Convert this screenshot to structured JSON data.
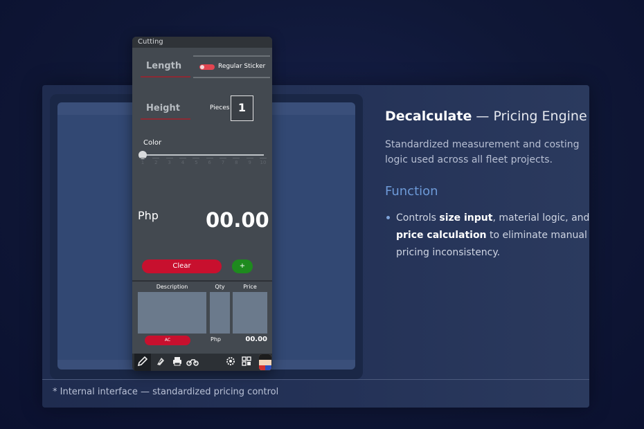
{
  "card": {
    "heading_bold": "Decalculate",
    "heading_rest": " — Pricing Engine",
    "description": "Standardized measurement and costing logic used across all fleet projects.",
    "function_title": "Function",
    "bullet": {
      "p1": "Controls ",
      "b1": "size input",
      "p2": ", material logic, and ",
      "b2": "price calculation",
      "p3": " to eliminate manual pricing inconsistency."
    },
    "footnote": "* Internal interface — standardized pricing control"
  },
  "app": {
    "title": "Cutting",
    "tabs": {
      "length": "Length",
      "height": "Height"
    },
    "sticker_toggle": {
      "label": "Regular Sticker",
      "on": true
    },
    "pieces": {
      "label": "Pieces",
      "value": "1"
    },
    "color": {
      "label": "Color",
      "value": 0,
      "ticks": [
        "1",
        "2",
        "3",
        "4",
        "5",
        "6",
        "7",
        "8",
        "9",
        "10"
      ]
    },
    "price": {
      "currency": "Php",
      "total": "00.00"
    },
    "buttons": {
      "clear": "Clear",
      "add": "+",
      "ac": "AC"
    },
    "table": {
      "headers": {
        "description": "Description",
        "qty": "Qty",
        "price": "Price"
      },
      "subtotal_currency": "Php",
      "subtotal": "00.00"
    },
    "taskbar": {
      "icons": [
        "pencil-icon",
        "sticker-roll-icon",
        "printer-icon",
        "motorcycle-icon",
        "gear-icon",
        "grid-icon",
        "avatar"
      ]
    }
  },
  "colors": {
    "accent_red": "#c8102e",
    "accent_green": "#1e8a1e",
    "function_blue": "#6d9ad8"
  }
}
